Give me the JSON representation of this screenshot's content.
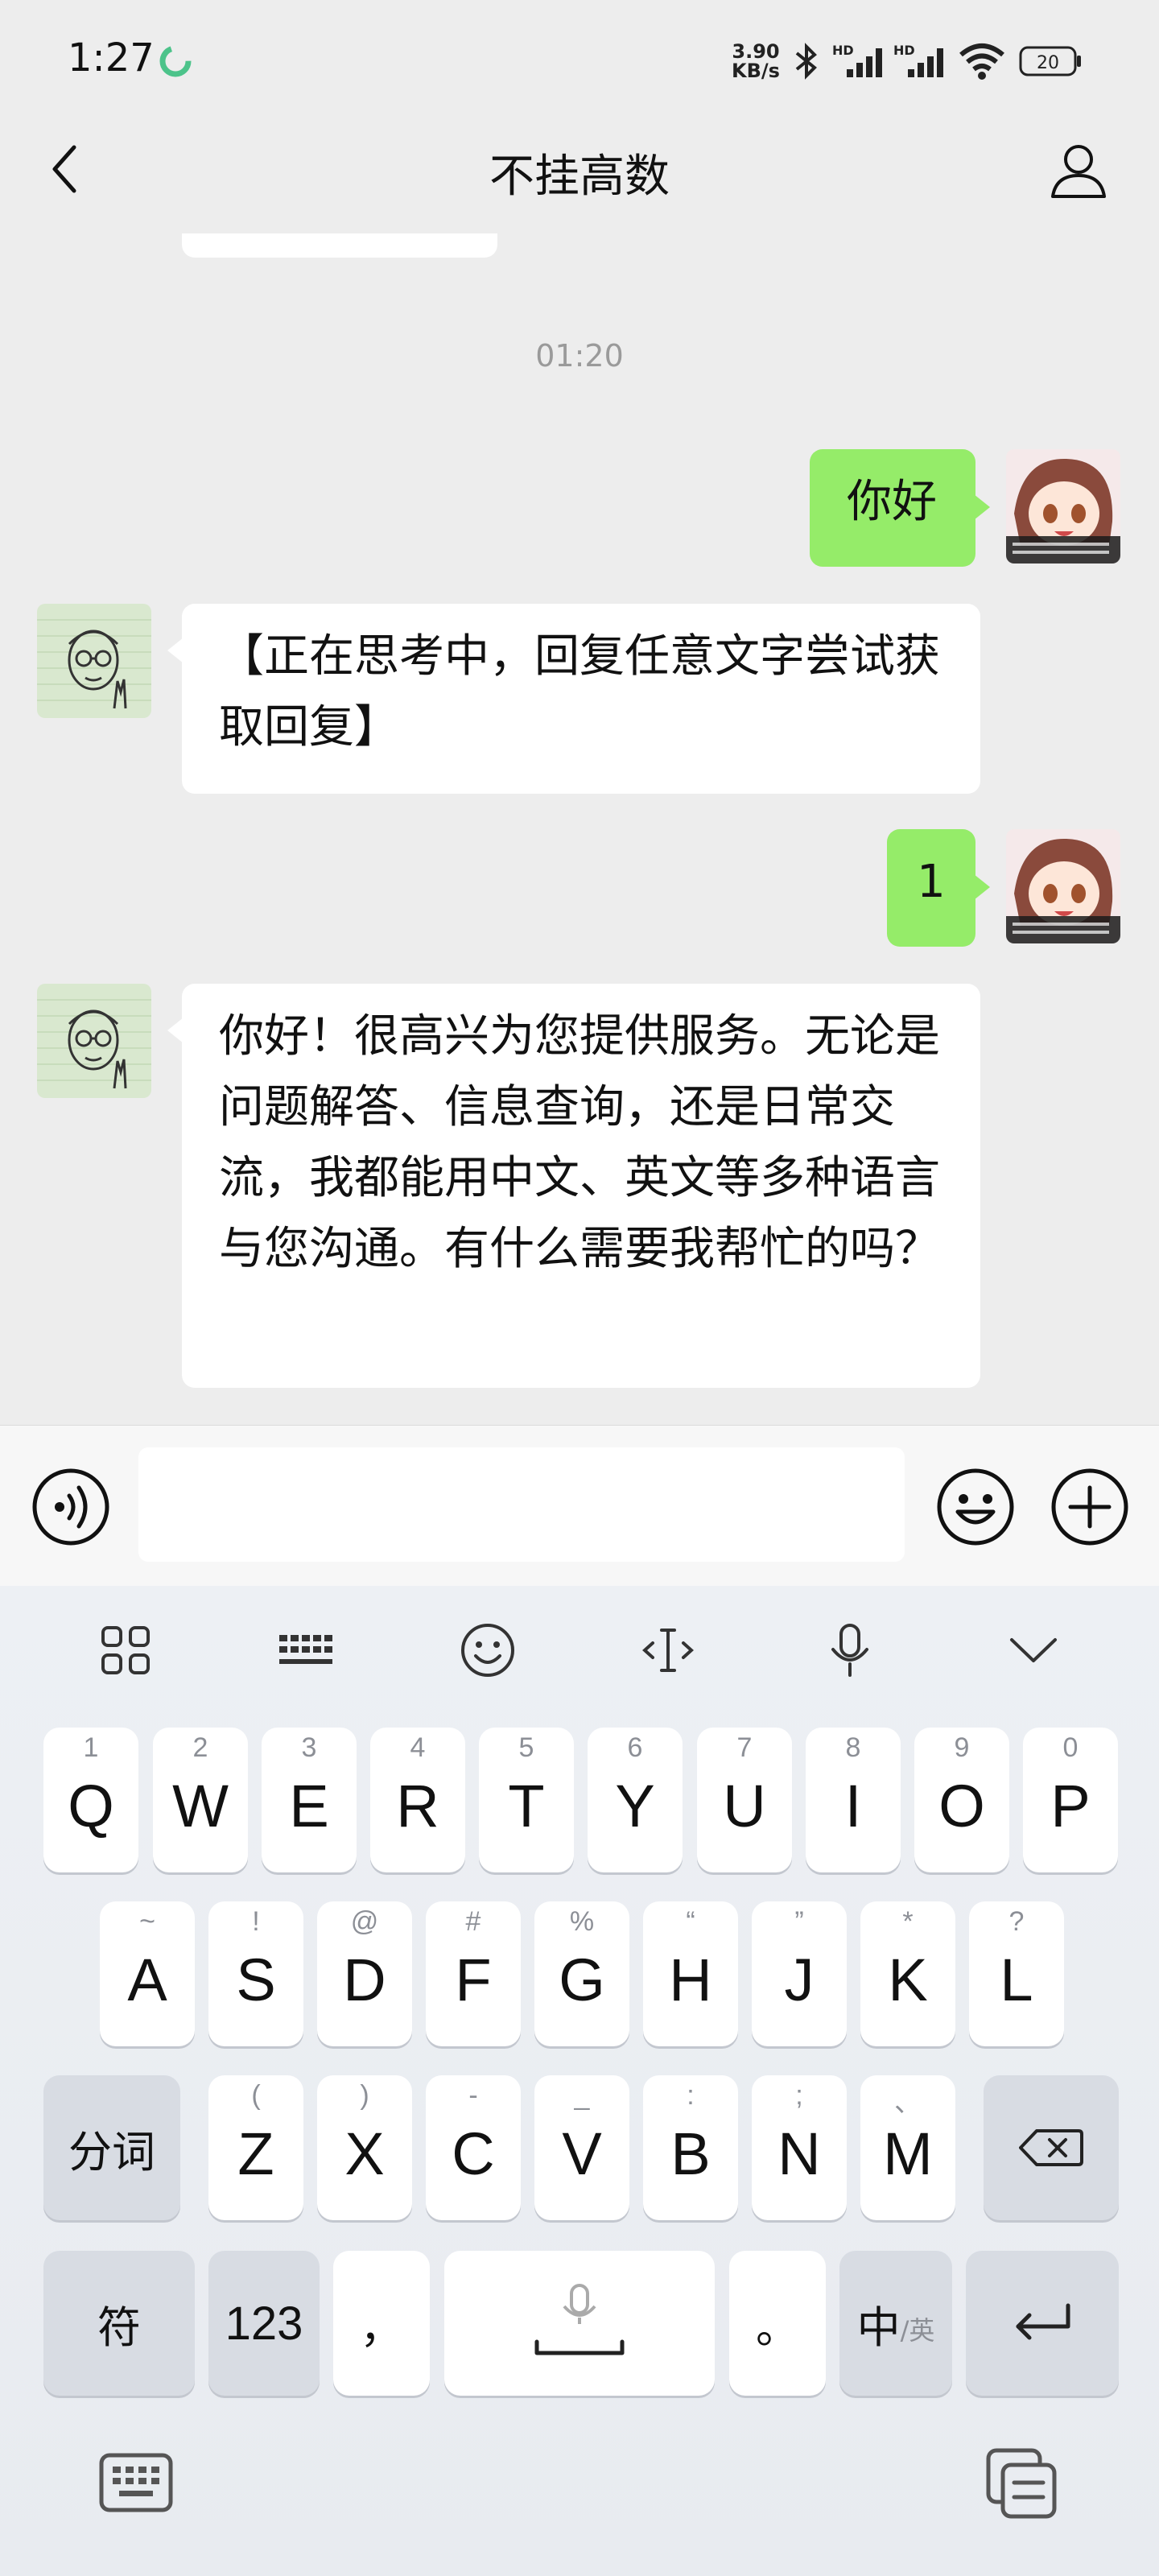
{
  "status_bar": {
    "time": "1:27",
    "net_speed_value": "3.90",
    "net_speed_unit": "KB/s",
    "signal_labels": [
      "HD",
      "HD"
    ],
    "battery": "20"
  },
  "header": {
    "title": "不挂高数"
  },
  "chat": {
    "timestamp": "01:20",
    "messages": [
      {
        "side": "out",
        "text": "你好"
      },
      {
        "side": "in",
        "text": "【正在思考中，回复任意文字尝试获取回复】"
      },
      {
        "side": "out",
        "text": "1"
      },
      {
        "side": "in",
        "text": "你好！很高兴为您提供服务。无论是问题解答、信息查询，还是日常交流，我都能用中文、英文等多种语言与您沟通。有什么需要我帮忙的吗？"
      }
    ]
  },
  "input": {
    "value": "",
    "placeholder": ""
  },
  "keyboard": {
    "toolbar_icons": [
      "grid-apps-icon",
      "keyboard-layout-icon",
      "emoji-icon",
      "cursor-icon",
      "microphone-icon",
      "chevron-down-icon"
    ],
    "row1": [
      {
        "key": "Q",
        "hint": "1"
      },
      {
        "key": "W",
        "hint": "2"
      },
      {
        "key": "E",
        "hint": "3"
      },
      {
        "key": "R",
        "hint": "4"
      },
      {
        "key": "T",
        "hint": "5"
      },
      {
        "key": "Y",
        "hint": "6"
      },
      {
        "key": "U",
        "hint": "7"
      },
      {
        "key": "I",
        "hint": "8"
      },
      {
        "key": "O",
        "hint": "9"
      },
      {
        "key": "P",
        "hint": "0"
      }
    ],
    "row2": [
      {
        "key": "A",
        "hint": "~"
      },
      {
        "key": "S",
        "hint": "!"
      },
      {
        "key": "D",
        "hint": "@"
      },
      {
        "key": "F",
        "hint": "#"
      },
      {
        "key": "G",
        "hint": "%"
      },
      {
        "key": "H",
        "hint": "“"
      },
      {
        "key": "J",
        "hint": "”"
      },
      {
        "key": "K",
        "hint": "*"
      },
      {
        "key": "L",
        "hint": "?"
      }
    ],
    "row3": [
      {
        "key": "Z",
        "hint": "("
      },
      {
        "key": "X",
        "hint": ")"
      },
      {
        "key": "C",
        "hint": "-"
      },
      {
        "key": "V",
        "hint": "_"
      },
      {
        "key": "B",
        "hint": ":"
      },
      {
        "key": "N",
        "hint": ";"
      },
      {
        "key": "M",
        "hint": "、"
      }
    ],
    "segment_label": "分词",
    "symbol_label": "符",
    "num_label": "123",
    "comma_label": "，",
    "period_label": "。",
    "lang_main": "中",
    "lang_sub": "/英"
  },
  "colors": {
    "background": "#ededed",
    "bubble_out": "#95ec69",
    "bubble_in": "#ffffff"
  }
}
